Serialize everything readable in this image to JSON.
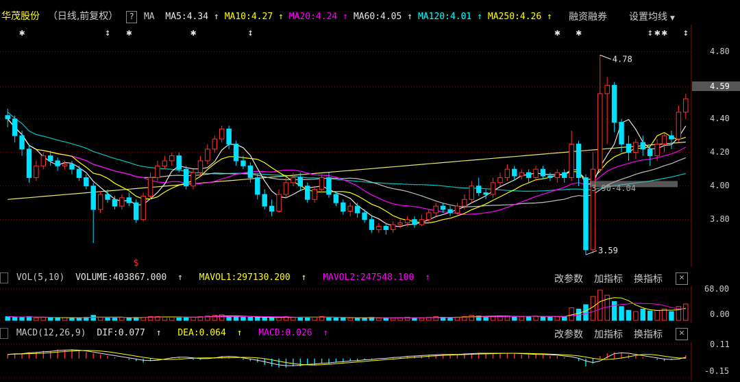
{
  "header": {
    "stock_name": "华茂股份",
    "period": "（日线,前复权）",
    "ma_box": "?",
    "ma_label": "MA",
    "mas": [
      {
        "text": "MA5:4.34",
        "arrow": "↑",
        "color": "#e6e6e6"
      },
      {
        "text": "MA10:4.27",
        "arrow": "↑",
        "color": "#ffff00"
      },
      {
        "text": "MA20:4.24",
        "arrow": "↑",
        "color": "#ff00ff"
      },
      {
        "text": "MA60:4.05",
        "arrow": "↑",
        "color": "#e6e6e6"
      },
      {
        "text": "MA120:4.01",
        "arrow": "↑",
        "color": "#00ffff"
      },
      {
        "text": "MA250:4.26",
        "arrow": "↑",
        "color": "#ffff00"
      }
    ],
    "margin_button": "融资融券",
    "settings_button": "设置均线"
  },
  "price_axis": {
    "ticks": [
      "4.80",
      "4.59",
      "4.40",
      "4.20",
      "4.00",
      "3.80"
    ],
    "current": "4.59"
  },
  "markers": {
    "high": "4.78",
    "low": "3.59",
    "ma_label": "3.90-4.04",
    "signal": "$"
  },
  "volume_panel": {
    "params": "VOL(5,10)",
    "volume": "VOLUME:403867.000",
    "mavol1": "MAVOL1:297130.200",
    "mavol2": "MAVOL2:247548.100",
    "arrow": "↑",
    "ticks": [
      "68.00",
      "0.00"
    ]
  },
  "macd_panel": {
    "params": "MACD(12,26,9)",
    "dif": "DIF:0.077",
    "dea": "DEA:0.064",
    "macd": "MACD:0.026",
    "arrow": "↑",
    "ticks": [
      "0.11",
      "-0.15"
    ]
  },
  "panel_buttons": {
    "change_params": "改参数",
    "add_indicator": "加指标",
    "switch_indicator": "换指标",
    "close": "✕"
  },
  "colors": {
    "up": "#ff3232",
    "down": "#00e0ff",
    "ma5": "#e6e6e6",
    "ma10": "#ffff00",
    "ma20": "#ff00ff",
    "ma60": "#c0c0c0",
    "ma120": "#00c8c8",
    "ma250": "#e8e86a",
    "grid": "#7a1010"
  },
  "chart_data": {
    "type": "candlestick",
    "ylim": [
      3.55,
      4.88
    ],
    "candles": [
      [
        4.42,
        4.4,
        4.46,
        4.35
      ],
      [
        4.4,
        4.3,
        4.42,
        4.26
      ],
      [
        4.3,
        4.22,
        4.33,
        4.18
      ],
      [
        4.22,
        4.05,
        4.25,
        4.02
      ],
      [
        4.05,
        4.12,
        4.15,
        4.03
      ],
      [
        4.12,
        4.18,
        4.2,
        4.1
      ],
      [
        4.18,
        4.15,
        4.21,
        4.12
      ],
      [
        4.15,
        4.12,
        4.17,
        4.09
      ],
      [
        4.12,
        4.13,
        4.15,
        4.1
      ],
      [
        4.13,
        4.1,
        4.15,
        4.07
      ],
      [
        4.1,
        4.05,
        4.12,
        4.03
      ],
      [
        4.05,
        4.0,
        4.07,
        3.98
      ],
      [
        4.0,
        3.86,
        4.02,
        3.66
      ],
      [
        3.86,
        3.95,
        3.97,
        3.84
      ],
      [
        3.95,
        3.92,
        3.98,
        3.9
      ],
      [
        3.92,
        3.88,
        3.94,
        3.86
      ],
      [
        3.88,
        3.93,
        3.95,
        3.86
      ],
      [
        3.93,
        3.9,
        3.96,
        3.88
      ],
      [
        3.9,
        3.8,
        3.92,
        3.78
      ],
      [
        3.8,
        3.94,
        3.96,
        3.79
      ],
      [
        3.94,
        4.05,
        4.08,
        3.92
      ],
      [
        4.05,
        4.12,
        4.15,
        4.03
      ],
      [
        4.12,
        4.15,
        4.18,
        4.1
      ],
      [
        4.15,
        4.18,
        4.2,
        4.12
      ],
      [
        4.18,
        4.1,
        4.2,
        4.08
      ],
      [
        4.1,
        4.0,
        4.12,
        3.98
      ],
      [
        4.0,
        4.08,
        4.1,
        3.98
      ],
      [
        4.08,
        4.15,
        4.18,
        4.06
      ],
      [
        4.15,
        4.22,
        4.25,
        4.13
      ],
      [
        4.22,
        4.28,
        4.3,
        4.2
      ],
      [
        4.28,
        4.34,
        4.36,
        4.26
      ],
      [
        4.34,
        4.25,
        4.36,
        4.22
      ],
      [
        4.25,
        4.15,
        4.27,
        4.12
      ],
      [
        4.15,
        4.12,
        4.18,
        4.1
      ],
      [
        4.12,
        4.05,
        4.14,
        4.02
      ],
      [
        4.05,
        3.95,
        4.07,
        3.92
      ],
      [
        3.95,
        3.88,
        3.98,
        3.86
      ],
      [
        3.88,
        3.85,
        3.92,
        3.82
      ],
      [
        3.85,
        3.95,
        3.98,
        3.84
      ],
      [
        3.95,
        4.02,
        4.05,
        3.93
      ],
      [
        4.02,
        4.05,
        4.08,
        4.0
      ],
      [
        4.05,
        4.0,
        4.08,
        3.97
      ],
      [
        4.0,
        3.92,
        4.02,
        3.9
      ],
      [
        3.92,
        3.98,
        4.0,
        3.9
      ],
      [
        3.98,
        4.05,
        4.07,
        3.96
      ],
      [
        4.05,
        3.95,
        4.08,
        3.93
      ],
      [
        3.95,
        3.9,
        3.97,
        3.88
      ],
      [
        3.9,
        3.85,
        3.92,
        3.83
      ],
      [
        3.85,
        3.88,
        3.9,
        3.82
      ],
      [
        3.88,
        3.84,
        3.9,
        3.81
      ],
      [
        3.84,
        3.8,
        3.86,
        3.78
      ],
      [
        3.8,
        3.74,
        3.82,
        3.72
      ],
      [
        3.74,
        3.76,
        3.78,
        3.72
      ],
      [
        3.76,
        3.74,
        3.78,
        3.71
      ],
      [
        3.74,
        3.77,
        3.79,
        3.72
      ],
      [
        3.77,
        3.78,
        3.8,
        3.75
      ],
      [
        3.78,
        3.8,
        3.82,
        3.76
      ],
      [
        3.8,
        3.77,
        3.82,
        3.75
      ],
      [
        3.77,
        3.8,
        3.83,
        3.76
      ],
      [
        3.8,
        3.84,
        3.86,
        3.78
      ],
      [
        3.84,
        3.88,
        3.9,
        3.82
      ],
      [
        3.88,
        3.86,
        3.9,
        3.84
      ],
      [
        3.86,
        3.84,
        3.88,
        3.82
      ],
      [
        3.84,
        3.88,
        3.9,
        3.83
      ],
      [
        3.88,
        3.92,
        3.95,
        3.86
      ],
      [
        3.92,
        4.0,
        4.03,
        3.9
      ],
      [
        4.0,
        3.96,
        4.05,
        3.94
      ],
      [
        3.96,
        3.95,
        3.98,
        3.92
      ],
      [
        3.95,
        4.02,
        4.05,
        3.93
      ],
      [
        4.02,
        4.05,
        4.08,
        4.0
      ],
      [
        4.05,
        4.1,
        4.13,
        4.03
      ],
      [
        4.1,
        4.06,
        4.12,
        4.03
      ],
      [
        4.06,
        4.08,
        4.1,
        4.04
      ],
      [
        4.08,
        4.05,
        4.1,
        4.02
      ],
      [
        4.05,
        4.1,
        4.12,
        4.03
      ],
      [
        4.1,
        4.06,
        4.12,
        4.04
      ],
      [
        4.06,
        4.05,
        4.08,
        4.03
      ],
      [
        4.05,
        4.08,
        4.1,
        4.02
      ],
      [
        4.08,
        4.05,
        4.1,
        4.02
      ],
      [
        4.05,
        4.25,
        4.33,
        4.03
      ],
      [
        4.25,
        4.05,
        4.27,
        4.0
      ],
      [
        4.05,
        3.62,
        4.07,
        3.59
      ],
      [
        3.62,
        4.1,
        4.2,
        3.6
      ],
      [
        4.1,
        4.55,
        4.78,
        4.08
      ],
      [
        4.55,
        4.6,
        4.65,
        4.25
      ],
      [
        4.6,
        4.38,
        4.62,
        4.32
      ],
      [
        4.38,
        4.25,
        4.4,
        4.2
      ],
      [
        4.25,
        4.2,
        4.3,
        4.15
      ],
      [
        4.2,
        4.26,
        4.28,
        4.16
      ],
      [
        4.26,
        4.22,
        4.3,
        4.18
      ],
      [
        4.22,
        4.18,
        4.24,
        4.12
      ],
      [
        4.18,
        4.25,
        4.28,
        4.15
      ],
      [
        4.25,
        4.3,
        4.32,
        4.2
      ],
      [
        4.3,
        4.28,
        4.33,
        4.22
      ],
      [
        4.28,
        4.44,
        4.48,
        4.26
      ],
      [
        4.44,
        4.52,
        4.55,
        4.4
      ]
    ],
    "volume_values": [
      6,
      5,
      5,
      6,
      4,
      5,
      4,
      4,
      5,
      4,
      4,
      5,
      8,
      5,
      4,
      4,
      5,
      4,
      5,
      5,
      6,
      6,
      5,
      5,
      5,
      5,
      5,
      6,
      7,
      8,
      9,
      6,
      6,
      5,
      5,
      5,
      4,
      4,
      5,
      6,
      5,
      5,
      5,
      5,
      6,
      5,
      4,
      4,
      4,
      4,
      4,
      5,
      4,
      4,
      4,
      4,
      5,
      4,
      4,
      5,
      6,
      5,
      4,
      5,
      6,
      8,
      7,
      6,
      6,
      7,
      7,
      6,
      6,
      6,
      7,
      6,
      6,
      6,
      6,
      20,
      18,
      25,
      38,
      48,
      40,
      30,
      22,
      16,
      14,
      18,
      15,
      16,
      18,
      14,
      22,
      26
    ],
    "macd_values": [
      0.03,
      0.04,
      0.04,
      0.05,
      0.05,
      0.06,
      0.06,
      0.07,
      0.07,
      0.07,
      0.06,
      0.05,
      0.04,
      0.03,
      0.02,
      0.01,
      0.0,
      -0.01,
      -0.02,
      -0.03,
      -0.02,
      -0.01,
      0.0,
      0.01,
      0.01,
      0.0,
      -0.01,
      -0.01,
      0.0,
      0.01,
      0.02,
      0.01,
      0.0,
      -0.01,
      -0.02,
      -0.03,
      -0.05,
      -0.06,
      -0.07,
      -0.07,
      -0.06,
      -0.06,
      -0.05,
      -0.05,
      -0.04,
      -0.04,
      -0.03,
      -0.03,
      -0.02,
      -0.02,
      -0.01,
      -0.01,
      0.0,
      0.0,
      0.01,
      0.01,
      0.02,
      0.02,
      0.02,
      0.03,
      0.03,
      0.03,
      0.03,
      0.03,
      0.04,
      0.04,
      0.04,
      0.04,
      0.04,
      0.04,
      0.04,
      0.04,
      0.03,
      0.03,
      0.03,
      0.03,
      0.02,
      0.02,
      0.01,
      0.0,
      -0.02,
      -0.06,
      -0.04,
      0.02,
      0.04,
      0.05,
      0.04,
      0.03,
      0.02,
      0.01,
      0.0,
      -0.01,
      -0.02,
      -0.01,
      0.0,
      0.026
    ]
  }
}
